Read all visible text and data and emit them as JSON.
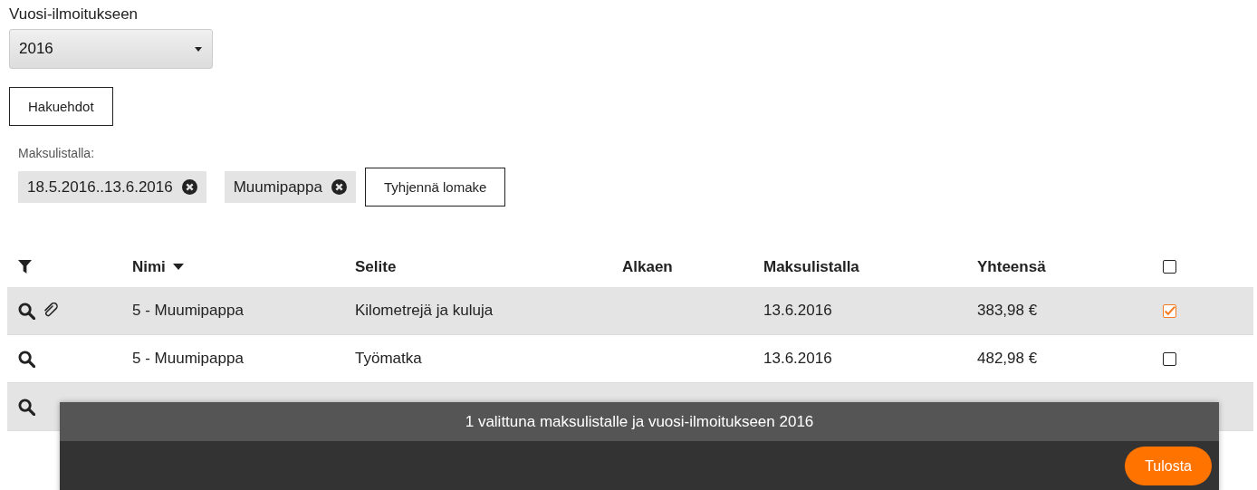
{
  "year_select": {
    "label": "Vuosi-ilmoitukseen",
    "value": "2016"
  },
  "search_button": "Hakuehdot",
  "filters": {
    "label": "Maksulistalla:",
    "chips": [
      "18.5.2016..13.6.2016",
      "Muumipappa"
    ],
    "clear_button": "Tyhjennä lomake"
  },
  "table": {
    "columns": [
      "Nimi",
      "Selite",
      "Alkaen",
      "Maksulistalla",
      "Yhteensä"
    ],
    "all_checked": false,
    "rows": [
      {
        "cells": [
          "5 - Muumipappa",
          "Kilometrejä ja kuluja",
          "",
          "13.6.2016",
          "383,98 €"
        ],
        "attachment": true,
        "checked": true
      },
      {
        "cells": [
          "5 - Muumipappa",
          "Työmatka",
          "",
          "13.6.2016",
          "482,98 €"
        ],
        "attachment": false,
        "checked": false
      },
      {
        "cells": [],
        "attachment": false
      }
    ]
  },
  "action_bar": {
    "message": "1 valittuna maksulistalle ja vuosi-ilmoitukseen 2016",
    "button": "Tulosta"
  }
}
